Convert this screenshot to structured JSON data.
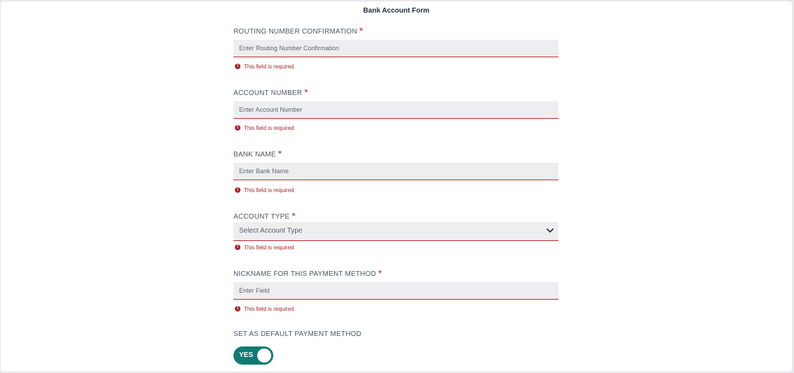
{
  "form": {
    "title": "Bank Account Form",
    "fields": [
      {
        "label": "ROUTING NUMBER CONFIRMATION",
        "required_mark": "*",
        "placeholder": "Enter Routing Number Confirmation",
        "error": "This field is required"
      },
      {
        "label": "ACCOUNT NUMBER",
        "required_mark": "*",
        "placeholder": "Enter Account Number",
        "error": "This field is required"
      },
      {
        "label": "BANK NAME",
        "required_mark": "*",
        "placeholder": "Enter Bank Name",
        "error": "This field is required"
      },
      {
        "label": "ACCOUNT TYPE",
        "required_mark": "*",
        "placeholder": "Select Account Type",
        "error": "This field is required"
      },
      {
        "label": "NICKNAME FOR THIS PAYMENT METHOD",
        "required_mark": "*",
        "placeholder": "Enter Field",
        "error": "This field is required"
      }
    ],
    "default_toggle": {
      "label": "SET AS DEFAULT PAYMENT METHOD",
      "state_text": "YES",
      "on": true
    }
  },
  "colors": {
    "error": "#c0282e",
    "toggle_on": "#0f7b73",
    "input_bg": "#eeeef0"
  }
}
